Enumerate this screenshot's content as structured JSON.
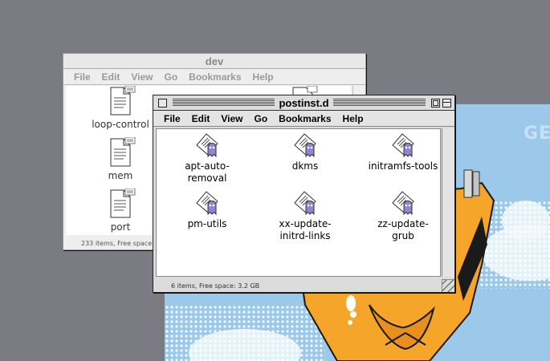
{
  "desktop": {
    "wallpaper_text": "GE"
  },
  "windows": {
    "dev": {
      "title": "dev",
      "menu": [
        "File",
        "Edit",
        "View",
        "Go",
        "Bookmarks",
        "Help"
      ],
      "items": [
        {
          "label": "loop-control",
          "icon": "text-document-icon"
        },
        {
          "label": "mem",
          "icon": "text-document-icon"
        },
        {
          "label": "port",
          "icon": "text-document-icon"
        }
      ],
      "status": "233 items, Free space:"
    },
    "postinst": {
      "title": "postinst.d",
      "menu": [
        "File",
        "Edit",
        "View",
        "Go",
        "Bookmarks",
        "Help"
      ],
      "items": [
        {
          "label": "apt-auto-removal",
          "icon": "script-document-icon"
        },
        {
          "label": "dkms",
          "icon": "script-document-icon"
        },
        {
          "label": "initramfs-tools",
          "icon": "script-document-icon"
        },
        {
          "label": "pm-utils",
          "icon": "script-document-icon"
        },
        {
          "label": "xx-update-initrd-links",
          "icon": "script-document-icon"
        },
        {
          "label": "zz-update-grub",
          "icon": "script-document-icon"
        }
      ],
      "label_lines": {
        "apt": [
          "apt-auto-",
          "removal"
        ],
        "xx": [
          "xx-update-",
          "initrd-links"
        ],
        "zz": [
          "zz-update-",
          "grub"
        ]
      },
      "status": "6 items, Free space: 3.2 GB"
    }
  },
  "colors": {
    "desktop": "#7b7c83",
    "wallpaper_sky": "#9cc9ea",
    "figure_orange": "#f4a52a",
    "ghost_purple": "#8d85d6"
  }
}
